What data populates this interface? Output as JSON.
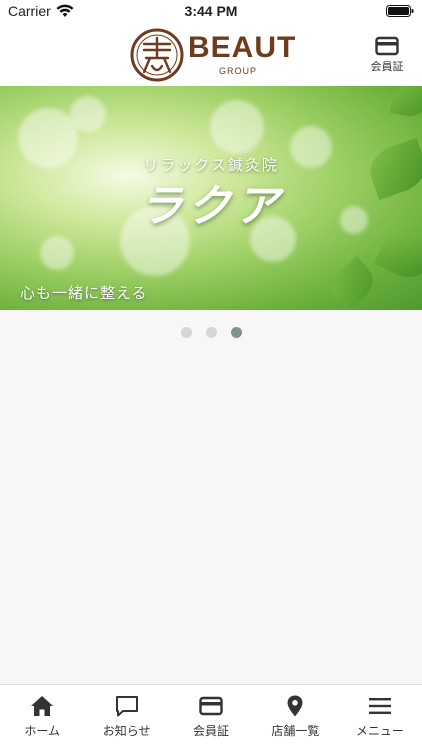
{
  "status_bar": {
    "carrier": "Carrier",
    "time": "3:44 PM"
  },
  "header": {
    "logo": {
      "word": "BEAUT",
      "sub": "GROUP",
      "emblem_text": "美好人",
      "brand_color": "#6f3b1e"
    },
    "member_card_label": "会員証"
  },
  "banner": {
    "subtitle": "リラックス鍼灸院",
    "title": "ラクア",
    "tagline": "心も一緒に整える"
  },
  "carousel": {
    "total": 3,
    "active_index": 2,
    "active_color": "#7f938d"
  },
  "tabbar": {
    "items": [
      {
        "label": "ホーム",
        "icon": "home-icon"
      },
      {
        "label": "お知らせ",
        "icon": "speech-bubble-icon"
      },
      {
        "label": "会員証",
        "icon": "card-icon"
      },
      {
        "label": "店舗一覧",
        "icon": "map-pin-icon"
      },
      {
        "label": "メニュー",
        "icon": "hamburger-icon"
      }
    ]
  }
}
